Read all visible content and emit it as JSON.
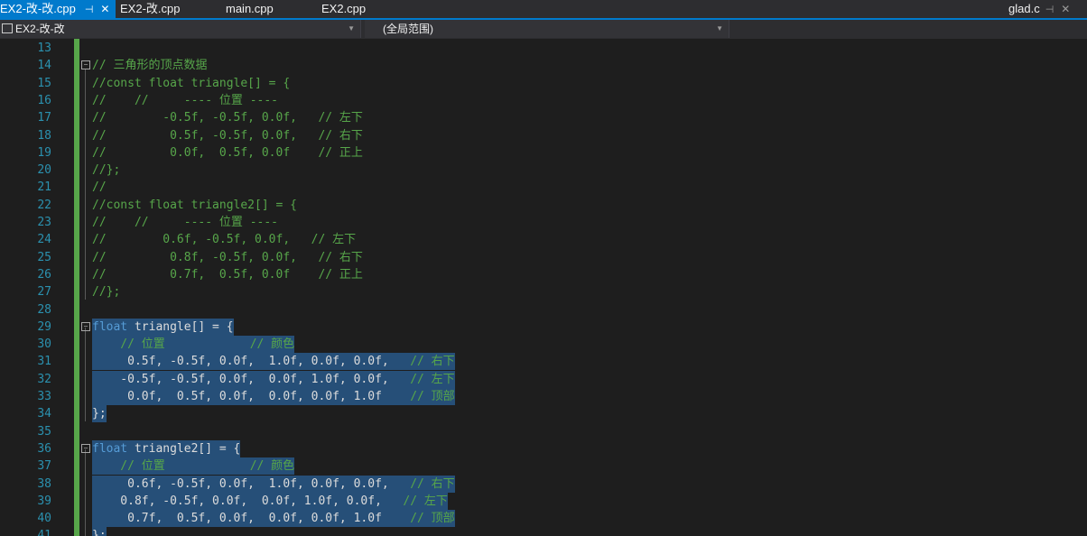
{
  "tabs": [
    {
      "label": "EX2-改-改.cpp",
      "active": true
    },
    {
      "label": "EX2-改.cpp"
    },
    {
      "label": "main.cpp"
    },
    {
      "label": "EX2.cpp"
    },
    {
      "label": "glad.c"
    }
  ],
  "nav": {
    "project": "EX2-改-改",
    "scope": "(全局范围)"
  },
  "lines": [
    {
      "n": "13",
      "t": ""
    },
    {
      "n": "14",
      "t": "// 三角形的顶点数据",
      "k": "cm"
    },
    {
      "n": "15",
      "t": "//const float triangle[] = {",
      "k": "cm"
    },
    {
      "n": "16",
      "t": "//    //     ---- 位置 ----",
      "k": "cm"
    },
    {
      "n": "17",
      "t": "//        -0.5f, -0.5f, 0.0f,   // 左下",
      "k": "cm"
    },
    {
      "n": "18",
      "t": "//         0.5f, -0.5f, 0.0f,   // 右下",
      "k": "cm"
    },
    {
      "n": "19",
      "t": "//         0.0f,  0.5f, 0.0f    // 正上",
      "k": "cm"
    },
    {
      "n": "20",
      "t": "//};",
      "k": "cm"
    },
    {
      "n": "21",
      "t": "//",
      "k": "cm"
    },
    {
      "n": "22",
      "t": "//const float triangle2[] = {",
      "k": "cm"
    },
    {
      "n": "23",
      "t": "//    //     ---- 位置 ----",
      "k": "cm"
    },
    {
      "n": "24",
      "t": "//        0.6f, -0.5f, 0.0f,   // 左下",
      "k": "cm"
    },
    {
      "n": "25",
      "t": "//         0.8f, -0.5f, 0.0f,   // 右下",
      "k": "cm"
    },
    {
      "n": "26",
      "t": "//         0.7f,  0.5f, 0.0f    // 正上",
      "k": "cm"
    },
    {
      "n": "27",
      "t": "//};",
      "k": "cm"
    },
    {
      "n": "28",
      "t": ""
    },
    {
      "n": "29",
      "kw": "float",
      "t": " triangle[] = {",
      "sel": true
    },
    {
      "n": "30",
      "t": "    // 位置            // 颜色",
      "k": "cm",
      "sel": true
    },
    {
      "n": "31",
      "t": "     0.5f, -0.5f, 0.0f,  1.0f, 0.0f, 0.0f,   ",
      "c": "// 右下",
      "sel": true
    },
    {
      "n": "32",
      "t": "    -0.5f, -0.5f, 0.0f,  0.0f, 1.0f, 0.0f,   ",
      "c": "// 左下",
      "sel": true
    },
    {
      "n": "33",
      "t": "     0.0f,  0.5f, 0.0f,  0.0f, 0.0f, 1.0f    ",
      "c": "// 顶部",
      "sel": true
    },
    {
      "n": "34",
      "t": "};",
      "sel": true
    },
    {
      "n": "35",
      "t": ""
    },
    {
      "n": "36",
      "kw": "float",
      "t": " triangle2[] = {",
      "sel": true
    },
    {
      "n": "37",
      "t": "    // 位置            // 颜色",
      "k": "cm",
      "sel": true
    },
    {
      "n": "38",
      "t": "     0.6f, -0.5f, 0.0f,  1.0f, 0.0f, 0.0f,   ",
      "c": "// 右下",
      "sel": true
    },
    {
      "n": "39",
      "t": "    0.8f, -0.5f, 0.0f,  0.0f, 1.0f, 0.0f,   ",
      "c": "// 左下",
      "sel": true
    },
    {
      "n": "40",
      "t": "     0.7f,  0.5f, 0.0f,  0.0f, 0.0f, 1.0f    ",
      "c": "// 顶部",
      "sel": true
    },
    {
      "n": "41",
      "t": "};",
      "sel": true
    }
  ]
}
